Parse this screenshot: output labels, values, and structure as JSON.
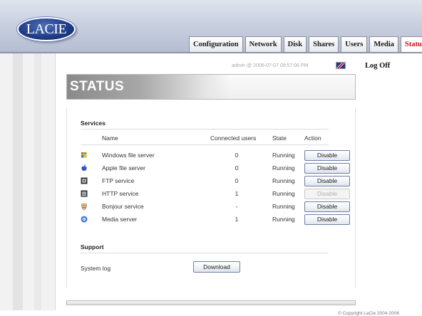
{
  "brand": {
    "logo_text": "LACIE"
  },
  "nav": {
    "tabs": [
      {
        "label": "Configuration",
        "active": false
      },
      {
        "label": "Network",
        "active": false
      },
      {
        "label": "Disk",
        "active": false
      },
      {
        "label": "Shares",
        "active": false
      },
      {
        "label": "Users",
        "active": false
      },
      {
        "label": "Media",
        "active": false
      },
      {
        "label": "Status",
        "active": true
      }
    ]
  },
  "session": {
    "user_info": "admin @ 2006-07-07 09:57:06 PM",
    "flag_icon": "uk-flag-icon",
    "logoff_label": "Log Off"
  },
  "page": {
    "title": "STATUS"
  },
  "services": {
    "section_title": "Services",
    "columns": {
      "name": "Name",
      "users": "Connected users",
      "state": "State",
      "action": "Action"
    },
    "rows": [
      {
        "icon": "windows-icon",
        "name": "Windows file server",
        "users": "0",
        "state": "Running",
        "action": "Disable",
        "enabled": true
      },
      {
        "icon": "apple-icon",
        "name": "Apple file server",
        "users": "0",
        "state": "Running",
        "action": "Disable",
        "enabled": true
      },
      {
        "icon": "ftp-icon",
        "name": "FTP service",
        "users": "0",
        "state": "Running",
        "action": "Disable",
        "enabled": true
      },
      {
        "icon": "http-icon",
        "name": "HTTP service",
        "users": "1",
        "state": "Running",
        "action": "Disable",
        "enabled": false
      },
      {
        "icon": "bonjour-icon",
        "name": "Bonjour service",
        "users": "-",
        "state": "Running",
        "action": "Disable",
        "enabled": true
      },
      {
        "icon": "media-server-icon",
        "name": "Media server",
        "users": "1",
        "state": "Running",
        "action": "Disable",
        "enabled": true
      }
    ]
  },
  "support": {
    "section_title": "Support",
    "system_log_label": "System log",
    "download_label": "Download"
  },
  "footer": {
    "copyright": "© Copyright LaCie 2004-2006"
  },
  "colors": {
    "active_tab": "#c0141e",
    "button_border": "#6d7fa6",
    "header_bg": "#c9d0e0"
  }
}
